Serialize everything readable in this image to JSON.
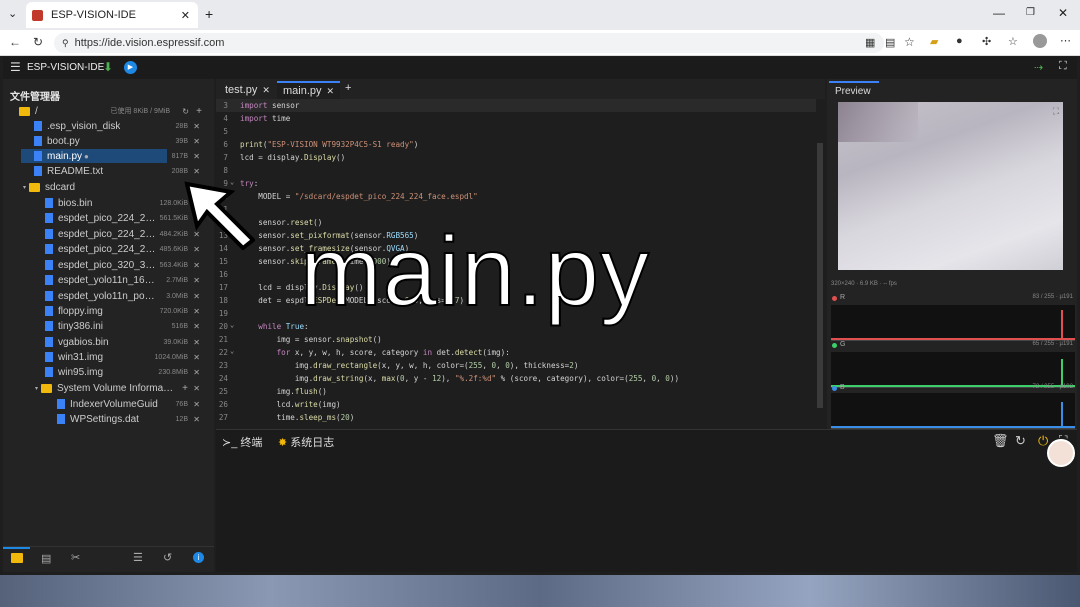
{
  "browser": {
    "tab_title": "ESP-VISION-IDE",
    "url": "https://ide.vision.espressif.com"
  },
  "app": {
    "title": "ESP-VISION-IDE"
  },
  "file_manager": {
    "title": "文件管理器",
    "root": "/",
    "usage": "已使用 8KiB / 9MiB",
    "files": [
      {
        "name": ".esp_vision_disk",
        "size": "28B"
      },
      {
        "name": "boot.py",
        "size": "39B"
      },
      {
        "name": "main.py",
        "size": "817B"
      },
      {
        "name": "README.txt",
        "size": "208B"
      }
    ],
    "sdcard": {
      "name": "sdcard",
      "files": [
        {
          "name": "bios.bin",
          "size": "128.0KiB"
        },
        {
          "name": "espdet_pico_224_22...",
          "size": "561.5KiB"
        },
        {
          "name": "espdet_pico_224_22...",
          "size": "484.2KiB"
        },
        {
          "name": "espdet_pico_224_22...",
          "size": "485.6KiB"
        },
        {
          "name": "espdet_pico_320_32...",
          "size": "563.4KiB"
        },
        {
          "name": "espdet_yolo11n_160_...",
          "size": "2.7MiB"
        },
        {
          "name": "espdet_yolo11n_pose...",
          "size": "3.0MiB"
        },
        {
          "name": "floppy.img",
          "size": "720.0KiB"
        },
        {
          "name": "tiny386.ini",
          "size": "516B"
        },
        {
          "name": "vgabios.bin",
          "size": "39.0KiB"
        },
        {
          "name": "win31.img",
          "size": "1024.0MiB"
        },
        {
          "name": "win95.img",
          "size": "230.8MiB"
        }
      ],
      "sysvol": {
        "name": "System Volume Informati...",
        "files": [
          {
            "name": "IndexerVolumeGuid",
            "size": "76B"
          },
          {
            "name": "WPSettings.dat",
            "size": "12B"
          }
        ]
      }
    }
  },
  "editor": {
    "tabs": [
      "test.py",
      "main.py"
    ],
    "active_tab": "main.py"
  },
  "preview": {
    "title": "Preview",
    "info": "320×240 · 6.9 KB · -- fps",
    "histograms": [
      {
        "label": "R",
        "value": "83 / 255 · µ191",
        "color": "#e05050"
      },
      {
        "label": "G",
        "value": "65 / 255 · µ191",
        "color": "#3ccf6a"
      },
      {
        "label": "B",
        "value": "72 / 255 · µ192",
        "color": "#3b8ee8"
      }
    ]
  },
  "terminal": {
    "tab_terminal": "终端",
    "tab_log": "系统日志"
  },
  "overlay_text": "main.py"
}
